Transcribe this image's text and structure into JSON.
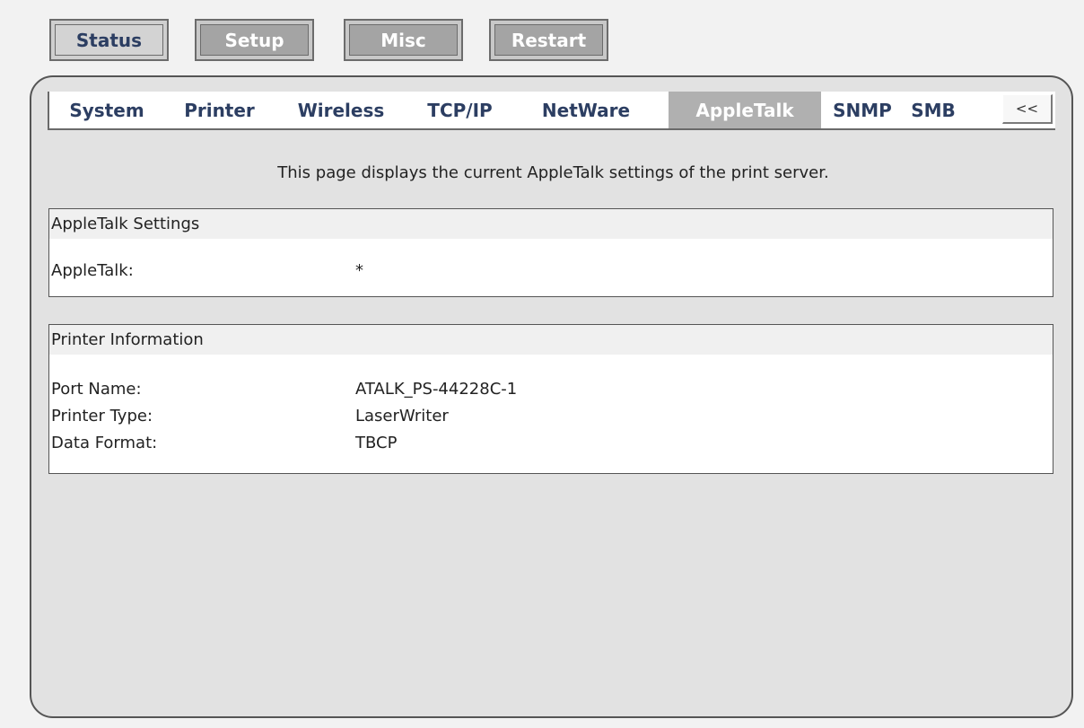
{
  "top_nav": {
    "status": "Status",
    "setup": "Setup",
    "misc": "Misc",
    "restart": "Restart"
  },
  "tabs": [
    {
      "label": "System"
    },
    {
      "label": "Printer"
    },
    {
      "label": "Wireless"
    },
    {
      "label": "TCP/IP"
    },
    {
      "label": "NetWare"
    },
    {
      "label": "AppleTalk",
      "active": true
    },
    {
      "label": "SNMP"
    },
    {
      "label": "SMB"
    }
  ],
  "collapse_label": "<<",
  "description": "This page displays the current AppleTalk settings of the print server.",
  "appletalk_settings": {
    "title": "AppleTalk Settings",
    "rows": [
      {
        "label": "AppleTalk:",
        "value": "*"
      }
    ]
  },
  "printer_information": {
    "title": "Printer Information",
    "rows": [
      {
        "label": "Port Name:",
        "value": "ATALK_PS-44228C-1"
      },
      {
        "label": "Printer Type:",
        "value": "LaserWriter"
      },
      {
        "label": "Data Format:",
        "value": "TBCP"
      }
    ]
  },
  "colors": {
    "accent_text": "#2c3e62",
    "active_tab_bg": "#b0b0b0",
    "panel_bg": "#e2e2e2"
  }
}
